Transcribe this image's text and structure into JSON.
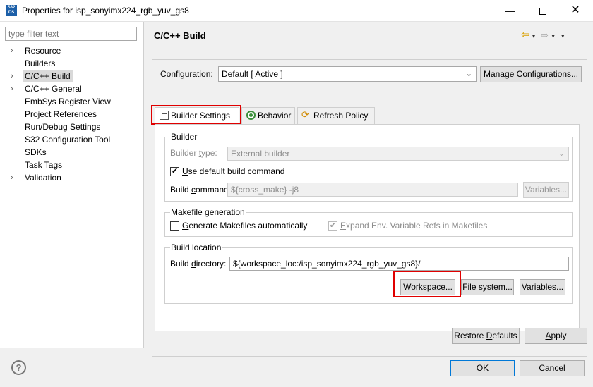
{
  "window": {
    "icon_text": "S32 DS",
    "title": "Properties for isp_sonyimx224_rgb_yuv_gs8",
    "minimize_glyph": "—",
    "close_glyph": "✕"
  },
  "sidebar": {
    "filter_placeholder": "type filter text",
    "items": [
      {
        "label": "Resource",
        "expandable": true
      },
      {
        "label": "Builders",
        "expandable": false
      },
      {
        "label": "C/C++ Build",
        "expandable": true,
        "selected": true
      },
      {
        "label": "C/C++ General",
        "expandable": true
      },
      {
        "label": "EmbSys Register View",
        "expandable": false
      },
      {
        "label": "Project References",
        "expandable": false
      },
      {
        "label": "Run/Debug Settings",
        "expandable": false
      },
      {
        "label": "S32 Configuration Tool",
        "expandable": false
      },
      {
        "label": "SDKs",
        "expandable": false
      },
      {
        "label": "Task Tags",
        "expandable": false
      },
      {
        "label": "Validation",
        "expandable": true
      }
    ]
  },
  "page": {
    "title": "C/C++ Build",
    "nav_back_icon": "⇦",
    "nav_forward_icon": "⇨",
    "nav_menu_icon": "▾"
  },
  "configuration": {
    "label": "Configuration:",
    "selected": "Default  [ Active ]",
    "manage_button": "Manage Configurations..."
  },
  "tabs": [
    {
      "label": "Builder Settings",
      "icon": "list-icon",
      "active": true
    },
    {
      "label": "Behavior",
      "icon": "behavior-icon",
      "active": false
    },
    {
      "label": "Refresh Policy",
      "icon": "refresh-icon",
      "active": false
    }
  ],
  "builder": {
    "group_title": "Builder",
    "type_label_pre": "Builder ",
    "type_label_u": "t",
    "type_label_post": "ype:",
    "type_value": "External builder",
    "use_default_pre": "",
    "use_default_u": "U",
    "use_default_post": "se default build command",
    "use_default_checked": true,
    "command_label_pre": "Build ",
    "command_label_u": "c",
    "command_label_post": "ommand:",
    "command_value": "${cross_make} -j8",
    "variables_button": "Variables..."
  },
  "makefile": {
    "group_title": "Makefile generation",
    "generate_pre": "",
    "generate_u": "G",
    "generate_post": "enerate Makefiles automatically",
    "generate_checked": false,
    "expand_pre": "",
    "expand_u": "E",
    "expand_post": "xpand Env. Variable Refs in Makefiles",
    "expand_checked": true
  },
  "location": {
    "group_title": "Build location",
    "dir_label_pre": "Build ",
    "dir_label_u": "d",
    "dir_label_post": "irectory:",
    "dir_value": "${workspace_loc:/isp_sonyimx224_rgb_yuv_gs8}/",
    "workspace_button": "Workspace...",
    "filesystem_button": "File system...",
    "variables_button": "Variables..."
  },
  "footer": {
    "restore_pre": "Restore ",
    "restore_u": "D",
    "restore_post": "efaults",
    "apply_u": "A",
    "apply_post": "pply",
    "ok": "OK",
    "cancel": "Cancel",
    "help_glyph": "?"
  },
  "colors": {
    "highlight_box": "#e00000",
    "accent": "#1c5fa8"
  }
}
